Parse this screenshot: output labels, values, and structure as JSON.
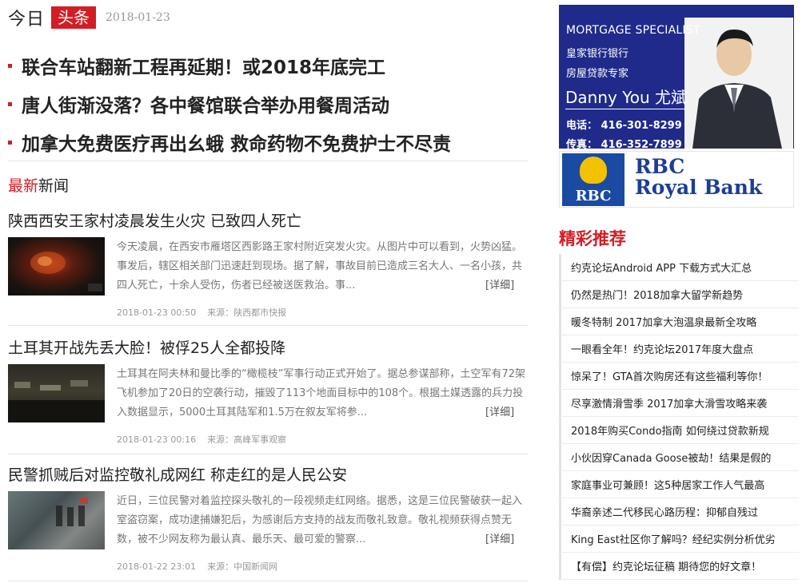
{
  "header": {
    "brand_a": "今日",
    "brand_b": "头条",
    "date": "2018-01-23"
  },
  "headlines": [
    "联合车站翻新工程再延期！或2018年底完工",
    "唐人街渐没落？各中餐馆联合举办用餐周活动",
    "加拿大免费医疗再出幺蛾 救命药物不免费护士不尽责"
  ],
  "section": {
    "title_red": "最新",
    "title_rest": "新闻"
  },
  "news": [
    {
      "title": "陕西西安王家村凌晨发生火灾 已致四人死亡",
      "body": "今天凌晨，在西安市雁塔区西影路王家村附近突发火灾。从图片中可以看到，火势凶猛。事发后，辖区相关部门迅速赶到现场。据了解，事故目前已造成三名大人、一名小孩，共四人死亡，十余人受伤，伤者已经被送医救治。事...",
      "more": "[详细]",
      "time": "2018-01-23 00:50",
      "source": "来源：陕西都市快报"
    },
    {
      "title": "土耳其开战先丢大脸！被俘25人全都投降",
      "body": "土耳其在阿夫林和曼比季的“橄榄枝”军事行动正式开始了。据总参谋部称，土空军有72架飞机参加了20日的空袭行动，摧毁了113个地面目标中的108个。根据土媒透露的兵力投入数据显示，5000土耳其陆军和1.5万在叙友军将参...",
      "more": "[详细]",
      "time": "2018-01-23 00:16",
      "source": "来源：高峰军事观察"
    },
    {
      "title": "民警抓贼后对监控敬礼成网红 称走红的是人民公安",
      "body": "近日，三位民警对着监控探头敬礼的一段视频走红网络。据悉，这是三位民警破获一起入室盗窃案，成功逮捕嫌犯后，为感谢后方支持的战友而敬礼致意。敬礼视频获得点赞无数，被不少网友称为最认真、最乐天、最可爱的警察...",
      "more": "[详细]",
      "time": "2018-01-22 23:01",
      "source": "来源：中国新闻网"
    }
  ],
  "ad": {
    "line1": "MORTGAGE SPECIALIST",
    "line2": "皇家银行银行",
    "line3": "房屋贷款专家",
    "name": "Danny You 尤斌",
    "tel": "电话：  416-301-8299",
    "fax": "传真：  416-352-7899",
    "rbc_small": "RBC",
    "rbc_line1": "RBC",
    "rbc_line2": "Royal Bank",
    "colors": {
      "blue": "#1f2a8a",
      "rbc_blue": "#1b3e96",
      "rbc_gold": "#f2c200"
    }
  },
  "recommend": {
    "title": "精彩推荐",
    "items": [
      "约克论坛Android APP 下载方式大汇总",
      "仍然是热门！2018加拿大留学新趋势",
      "暖冬特制 2017加拿大泡温泉最新全攻略",
      "一眼看全年！约克论坛2017年度大盘点",
      "惊呆了！GTA首次购房还有这些福利等你！",
      "尽享激情滑雪季 2017加拿大滑雪攻略来袭",
      "2018年购买Condo指南 如何绕过贷款新规",
      "小伙因穿Canada Goose被劫！结果是假的",
      "家庭事业可兼顾！这5种居家工作人气最高",
      "华裔亲述二代移民心路历程：抑郁自残过",
      "King East社区你了解吗？经纪实例分析优劣",
      "【有偿】约克论坛征稿 期待您的好文章！"
    ]
  },
  "theme": {
    "accent": "#d31d24"
  }
}
